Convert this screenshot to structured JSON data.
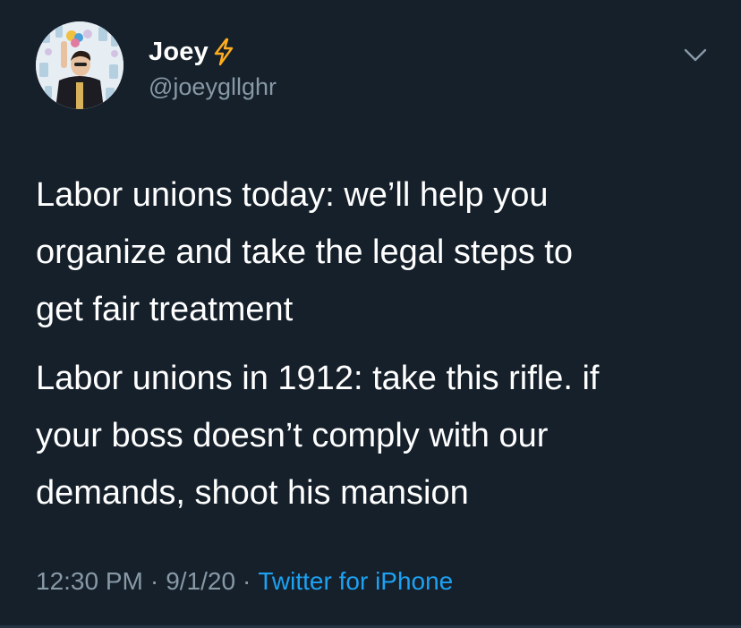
{
  "user": {
    "display_name": "Joey",
    "handle": "@joeygllghr",
    "badge_icon": "lightning-bolt-icon",
    "avatar_icon": "avatar-photo"
  },
  "tweet": {
    "paragraphs": [
      "Labor unions today: we’ll help you\norganize and take the legal steps to\nget fair treatment",
      "Labor unions in 1912: take this rifle. if\nyour boss doesn’t comply with our\ndemands, shoot his mansion"
    ],
    "time": "12:30 PM",
    "date": "9/1/20",
    "separator": "·",
    "source": "Twitter for iPhone"
  },
  "colors": {
    "background": "#15202b",
    "text": "#ffffff",
    "secondary": "#8899a6",
    "link": "#1da1f2",
    "bolt": "#ffad1f"
  },
  "menu_icon": "chevron-down-icon"
}
